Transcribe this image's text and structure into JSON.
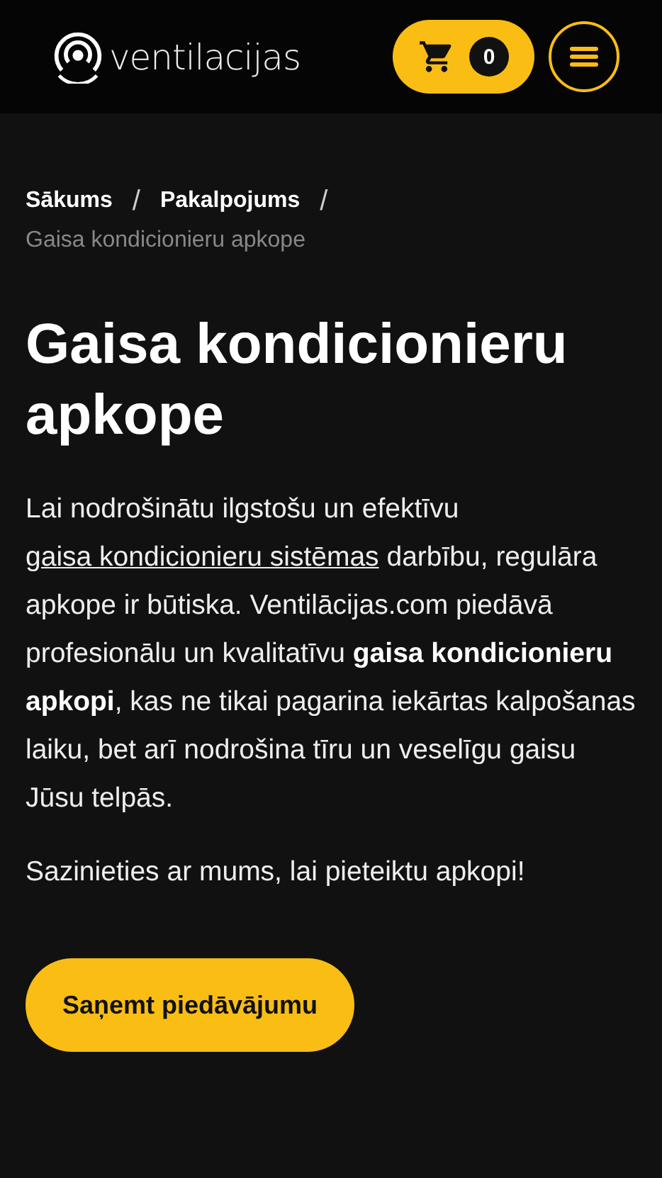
{
  "header": {
    "logo_text": "ventilacijas",
    "cart_count": "0"
  },
  "breadcrumb": {
    "items": [
      {
        "label": "Sākums",
        "separator": "/"
      },
      {
        "label": "Pakalpojums",
        "separator": "/"
      }
    ],
    "current": "Gaisa kondicionieru apkope"
  },
  "title": "Gaisa kondicionieru apkope",
  "intro": {
    "before": "Lai nodrošinātu ilgstošu un efektīvu",
    "link": "gaisa kondicionieru sistēmas",
    "after": "darbību, regulāra apkope ir būtiska. Ventilācijas.com piedāvā profesionālu un kvalitatīvu **gaisa kondicionieru apkopi**, kas ne tikai pagarina iekārtas kalpošanas laiku, bet arī nodrošina tīru un veselīgu gaisu Jūsu telpās."
  },
  "contact_text": "Sazinieties ar mums, lai pieteiktu apkopi!",
  "cta_button": "Saņemt piedāvājumu"
}
